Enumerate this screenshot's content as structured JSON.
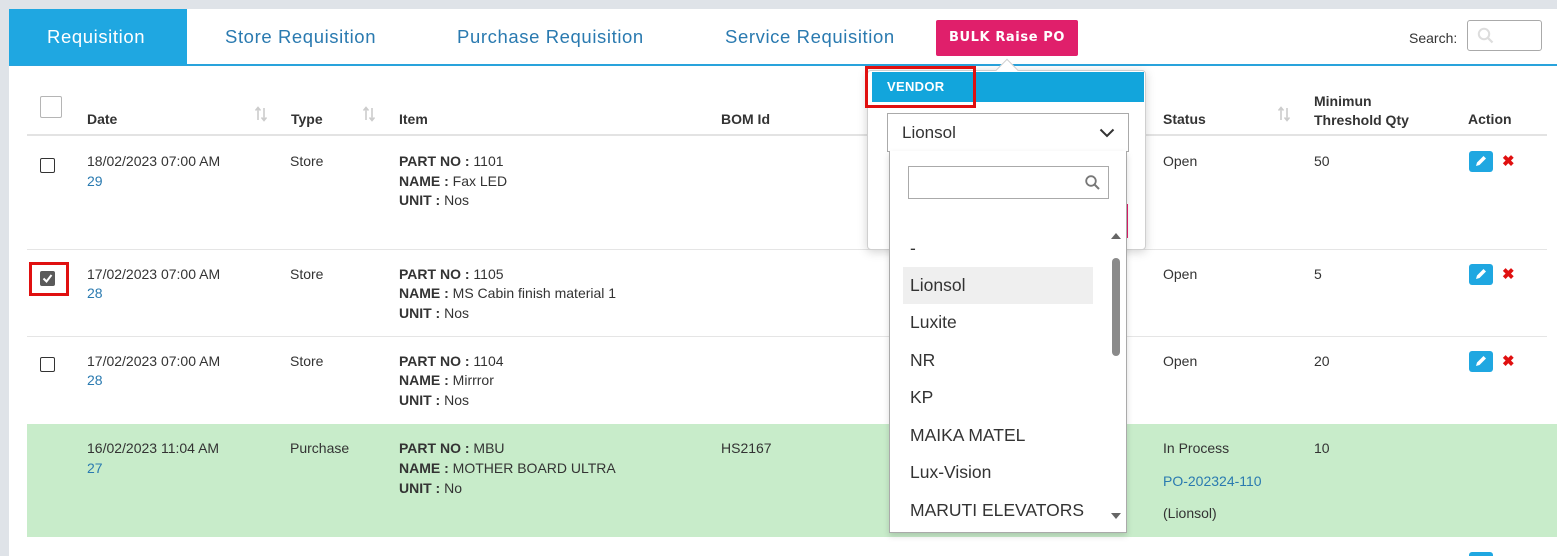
{
  "tabs": [
    {
      "label": "Requisition",
      "active": true
    },
    {
      "label": "Store Requisition",
      "active": false
    },
    {
      "label": "Purchase Requisition",
      "active": false
    },
    {
      "label": "Service Requisition",
      "active": false
    }
  ],
  "bulk_button": "BULK Raise PO",
  "search": {
    "label": "Search:",
    "value": ""
  },
  "table": {
    "headers": {
      "date": "Date",
      "type": "Type",
      "item": "Item",
      "bom": "BOM Id",
      "status": "Status",
      "min_threshold": "Minimun Threshold Qty",
      "action": "Action"
    },
    "rows": [
      {
        "date": "18/02/2023 07:00 AM",
        "id": "29",
        "type": "Store",
        "part_label": "PART NO :",
        "part": "1101",
        "name_label": "NAME :",
        "name": "Fax LED",
        "unit_label": "UNIT :",
        "unit": "Nos",
        "bom": "",
        "status": "Open",
        "qty": "50",
        "checked": false
      },
      {
        "date": "17/02/2023 07:00 AM",
        "id": "28",
        "type": "Store",
        "part_label": "PART NO :",
        "part": "1105",
        "name_label": "NAME :",
        "name": "MS Cabin finish material 1",
        "unit_label": "UNIT :",
        "unit": "Nos",
        "bom": "",
        "status": "Open",
        "qty": "5",
        "checked": true
      },
      {
        "date": "17/02/2023 07:00 AM",
        "id": "28",
        "type": "Store",
        "part_label": "PART NO :",
        "part": "1104",
        "name_label": "NAME :",
        "name": "Mirrror",
        "unit_label": "UNIT :",
        "unit": "Nos",
        "bom": "",
        "status": "Open",
        "qty": "20",
        "checked": false
      },
      {
        "date": "16/02/2023 11:04 AM",
        "id": "27",
        "type": "Purchase",
        "part_label": "PART NO :",
        "part": "MBU",
        "name_label": "NAME :",
        "name": "MOTHER BOARD ULTRA",
        "unit_label": "UNIT :",
        "unit": "No",
        "bom": "HS2167",
        "status": "In Process",
        "po": "PO-202324-110",
        "vendor": "(Lionsol)",
        "qty": "10"
      }
    ]
  },
  "vendor_popover": {
    "title": "VENDOR",
    "selected": "Lionsol",
    "search_value": "",
    "options": [
      "-",
      "Lionsol",
      "Luxite",
      "NR",
      "KP",
      "MAIKA MATEL",
      "Lux-Vision",
      "MARUTI ELEVATORS"
    ]
  },
  "colors": {
    "accent": "#1fa7e1",
    "bulk_button": "#e01f6b",
    "row_highlight": "#c8ecca",
    "delete": "#e01010",
    "link": "#2a7ab0"
  }
}
